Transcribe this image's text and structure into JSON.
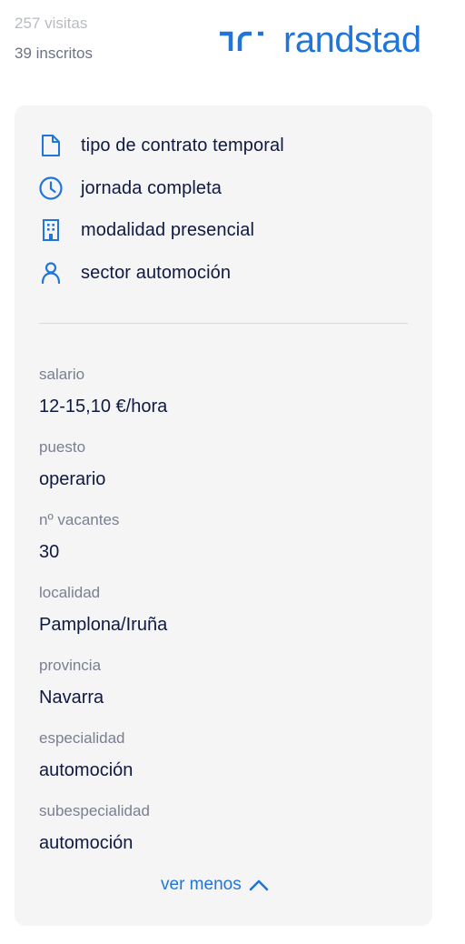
{
  "stats": {
    "visits": "257 visitas",
    "enrolled": "39 inscritos"
  },
  "brand": {
    "name": "randstad",
    "color": "#2175d9"
  },
  "features": [
    {
      "icon": "document-icon",
      "label": "tipo de contrato temporal"
    },
    {
      "icon": "clock-icon",
      "label": "jornada completa"
    },
    {
      "icon": "building-icon",
      "label": "modalidad presencial"
    },
    {
      "icon": "person-icon",
      "label": "sector automoción"
    }
  ],
  "details": [
    {
      "label": "salario",
      "value": "12-15,10 €/hora"
    },
    {
      "label": "puesto",
      "value": "operario"
    },
    {
      "label": "nº vacantes",
      "value": "30"
    },
    {
      "label": "localidad",
      "value": "Pamplona/Iruña"
    },
    {
      "label": "provincia",
      "value": "Navarra"
    },
    {
      "label": "especialidad",
      "value": "automoción"
    },
    {
      "label": "subespecialidad",
      "value": "automoción"
    }
  ],
  "toggle": {
    "label": "ver menos"
  }
}
